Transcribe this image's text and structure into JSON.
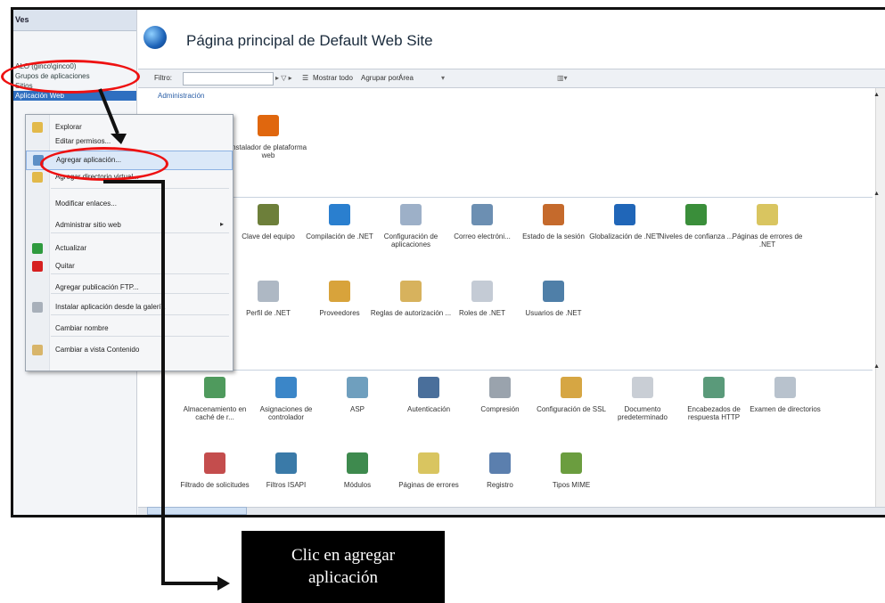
{
  "tree": {
    "header": "Ves",
    "nodes": [
      "ALO (ginco\\ginco0)",
      "Grupos de aplicaciones",
      "Sitios",
      "Aplicación Web"
    ]
  },
  "content": {
    "title": "Página principal de Default Web Site",
    "filter": {
      "label": "Filtro:",
      "show_all": "Mostrar todo",
      "group_by_label": "Agrupar por:",
      "group_by_value": "Área"
    },
    "sections": [
      {
        "label": "Administración"
      },
      {
        "label": ""
      },
      {
        "label": ""
      }
    ],
    "admin_icons": [
      {
        "label": "Instalador de plataforma web",
        "color": "#e0670e"
      }
    ],
    "aspnet_icons": [
      {
        "label": "Clave del equipo",
        "color": "#6d7f3a"
      },
      {
        "label": "Compilación de .NET",
        "color": "#2a7fcf"
      },
      {
        "label": "Configuración de aplicaciones",
        "color": "#9db0c8"
      },
      {
        "label": "Correo electróni...",
        "color": "#6c8fb2"
      },
      {
        "label": "Estado de la sesión",
        "color": "#c56a2c"
      },
      {
        "label": "Globalización de .NET",
        "color": "#2066b8"
      },
      {
        "label": "Niveles de confianza ...",
        "color": "#3a8e3a"
      },
      {
        "label": "Páginas de errores de .NET",
        "color": "#d9c560"
      },
      {
        "label": "Perfil de .NET",
        "color": "#aeb8c4"
      },
      {
        "label": "Proveedores",
        "color": "#d8a33b"
      },
      {
        "label": "Reglas de autorización ...",
        "color": "#d7b25d"
      },
      {
        "label": "Roles de .NET",
        "color": "#c4cbd5"
      },
      {
        "label": "Usuarios de .NET",
        "color": "#4f7fa8"
      }
    ],
    "iis_icons": [
      {
        "label": "Almacenamiento en caché de r...",
        "color": "#4f9a5d"
      },
      {
        "label": "Asignaciones de controlador",
        "color": "#3b86c8"
      },
      {
        "label": "ASP",
        "color": "#6f9fbe"
      },
      {
        "label": "Autenticación",
        "color": "#4a6f9b"
      },
      {
        "label": "Compresión",
        "color": "#9aa3ad"
      },
      {
        "label": "Configuración de SSL",
        "color": "#d6a643"
      },
      {
        "label": "Documento predeterminado",
        "color": "#c9ced5"
      },
      {
        "label": "Encabezados de respuesta HTTP",
        "color": "#5a9a7a"
      },
      {
        "label": "Examen de directorios",
        "color": "#b8c2cd"
      },
      {
        "label": "Filtrado de solicitudes",
        "color": "#c44d4d"
      },
      {
        "label": "Filtros ISAPI",
        "color": "#3a7aa8"
      },
      {
        "label": "Módulos",
        "color": "#3e8a4e"
      },
      {
        "label": "Páginas de errores",
        "color": "#d9c560"
      },
      {
        "label": "Registro",
        "color": "#5b7fae"
      },
      {
        "label": "Tipos MIME",
        "color": "#6b9d3f"
      }
    ]
  },
  "menu": {
    "items": [
      {
        "label": "Explorar",
        "icon": "folder-icon",
        "color": "#e2b94a"
      },
      {
        "label": "Editar permisos...",
        "icon": "",
        "color": ""
      },
      {
        "label": "Agregar aplicación...",
        "icon": "add-application-icon",
        "color": "#5c8fc6"
      },
      {
        "label": "Agregar directorio virtual...",
        "icon": "add-folder-icon",
        "color": "#e2b94a"
      },
      {
        "label": "Modificar enlaces...",
        "icon": "",
        "color": ""
      },
      {
        "label": "Administrar sitio web",
        "icon": "",
        "color": ""
      },
      {
        "label": "Actualizar",
        "icon": "refresh-icon",
        "color": "#2e9a3e"
      },
      {
        "label": "Quitar",
        "icon": "remove-icon",
        "color": "#d62020"
      },
      {
        "label": "Agregar publicación FTP...",
        "icon": "",
        "color": ""
      },
      {
        "label": "Instalar aplicación desde la galería",
        "icon": "gallery-icon",
        "color": "#a8b0ba"
      },
      {
        "label": "Cambiar nombre",
        "icon": "",
        "color": ""
      },
      {
        "label": "Cambiar a vista Contenido",
        "icon": "content-view-icon",
        "color": "#d8b56a"
      }
    ]
  },
  "callout": {
    "line1": "Clic en agregar",
    "line2": "aplicación"
  },
  "annotation_color": "#e11111"
}
